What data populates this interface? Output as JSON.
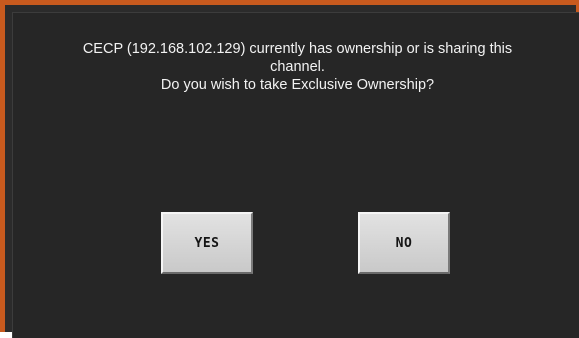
{
  "dialog": {
    "message_line1": "CECP (192.168.102.129) currently has ownership or is sharing this",
    "message_line2": "channel.",
    "message_line3": "Do you wish to take Exclusive Ownership?",
    "yes_label": "YES",
    "no_label": "NO"
  },
  "colors": {
    "frame_accent": "#c85a1e",
    "background": "#262626",
    "text": "#f2f2f2",
    "button_face": "#d6d6d6"
  }
}
